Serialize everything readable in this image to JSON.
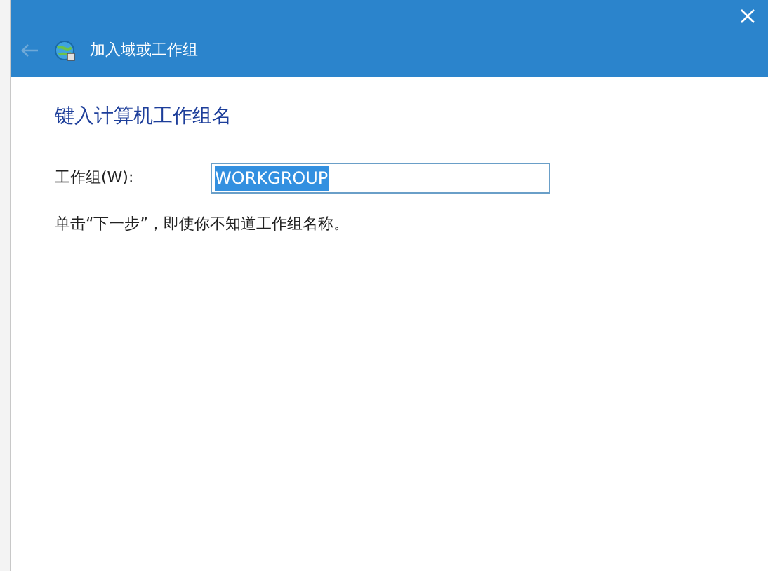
{
  "window": {
    "title": "加入域或工作组",
    "back_enabled": false
  },
  "heading": "键入计算机工作组名",
  "field": {
    "label": "工作组(W):",
    "value": "WORKGROUP",
    "text_selected": true
  },
  "note": "单击“下一步”，即使你不知道工作组名称。"
}
